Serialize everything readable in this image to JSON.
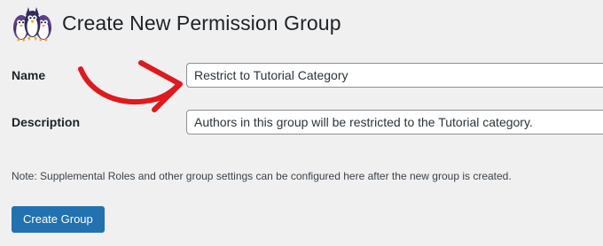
{
  "page": {
    "title": "Create New Permission Group"
  },
  "form": {
    "name_label": "Name",
    "name_value": "Restrict to Tutorial Category",
    "description_label": "Description",
    "description_value": "Authors in this group will be restricted to the Tutorial category.",
    "note": "Note: Supplemental Roles and other group settings can be configured here after the new group is created.",
    "submit_label": "Create Group"
  },
  "icons": {
    "logo": "penguins-logo",
    "annotation": "red-curved-arrow"
  },
  "colors": {
    "background": "#f0f0f1",
    "primary_button": "#2271b1",
    "arrow": "#e0191c",
    "input_border": "#8c8f94"
  }
}
